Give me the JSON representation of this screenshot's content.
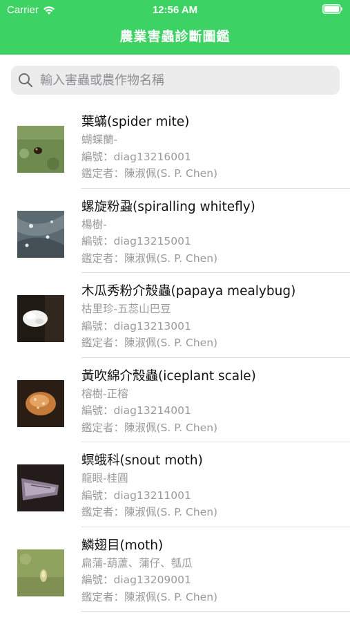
{
  "status": {
    "carrier": "Carrier",
    "time": "12:56 AM"
  },
  "header": {
    "title": "農業害蟲診斷圖鑑"
  },
  "search": {
    "placeholder": "輸入害蟲或農作物名稱",
    "icon": "search-icon"
  },
  "colors": {
    "header_bg": "#3dd364",
    "search_bg": "#ececec"
  },
  "items": [
    {
      "name": "葉蟎(spider mite)",
      "host": "蝴蝶蘭-",
      "code": "編號：diag13216001",
      "examiner": "鑑定者：陳淑佩(S. P. Chen)"
    },
    {
      "name": "螺旋粉蝨(spiralling whitefly)",
      "host": "楊樹-",
      "code": "編號：diag13215001",
      "examiner": "鑑定者：陳淑佩(S. P. Chen)"
    },
    {
      "name": "木瓜秀粉介殼蟲(papaya mealybug)",
      "host": "枯里珍-五蕊山巴豆",
      "code": "編號：diag13213001",
      "examiner": "鑑定者：陳淑佩(S. P. Chen)"
    },
    {
      "name": "黃吹綿介殼蟲(iceplant scale)",
      "host": "榕樹-正榕",
      "code": "編號：diag13214001",
      "examiner": "鑑定者：陳淑佩(S. P. Chen)"
    },
    {
      "name": "螟蛾科(snout moth)",
      "host": "龍眼-桂圓",
      "code": "編號：diag13211001",
      "examiner": "鑑定者：陳淑佩(S. P. Chen)"
    },
    {
      "name": "鱗翅目(moth)",
      "host": "扁蒲-葫蘆、蒲仔、瓠瓜",
      "code": "編號：diag13209001",
      "examiner": "鑑定者：陳淑佩(S. P. Chen)"
    }
  ]
}
